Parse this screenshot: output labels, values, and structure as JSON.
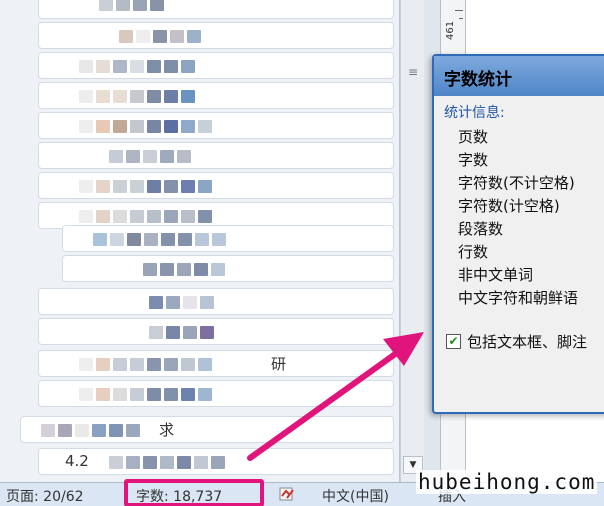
{
  "navigation": {
    "visible_fragments": [
      "研",
      "求",
      "4.2"
    ]
  },
  "ruler": {
    "page_number": "461"
  },
  "dialog": {
    "title": "字数统计",
    "stats_header": "统计信息:",
    "stats": [
      "页数",
      "字数",
      "字符数(不计空格)",
      "字符数(计空格)",
      "段落数",
      "行数",
      "非中文单词",
      "中文字符和朝鲜语"
    ],
    "include_textbox_label": "包括文本框、脚注",
    "include_textbox_checked": "✔"
  },
  "status_bar": {
    "page": "页面: 20/62",
    "word_count": "字数: 18,737",
    "language": "中文(中国)",
    "insert_mode": "插入"
  },
  "watermark": "hubeihong.com",
  "colors": {
    "annotation": "#e0147a",
    "dialog_border": "#2d6bb8",
    "status_bar": "#dbe6f4"
  }
}
